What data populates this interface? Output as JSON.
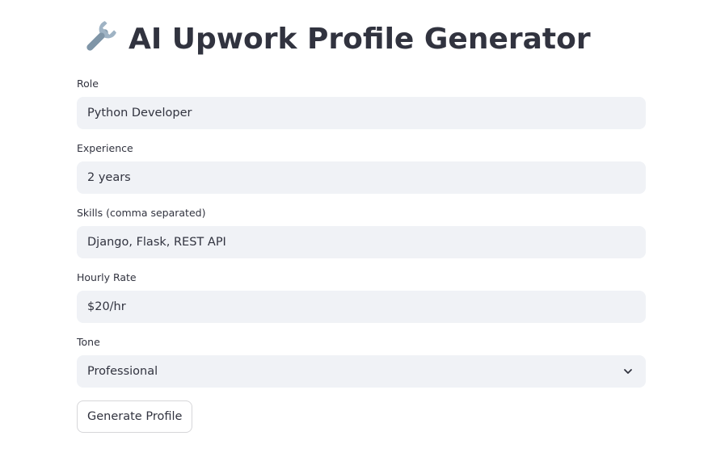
{
  "header": {
    "title": "AI Upwork Profile Generator",
    "icon": "wrench-icon"
  },
  "form": {
    "role": {
      "label": "Role",
      "value": "Python Developer"
    },
    "experience": {
      "label": "Experience",
      "value": "2 years"
    },
    "skills": {
      "label": "Skills (comma separated)",
      "value": "Django, Flask, REST API"
    },
    "rate": {
      "label": "Hourly Rate",
      "value": "$20/hr"
    },
    "tone": {
      "label": "Tone",
      "value": "Professional"
    },
    "submit_label": "Generate Profile"
  },
  "colors": {
    "input_background": "#f0f2f6",
    "text": "#31333f",
    "icon_wrench": "#7a8fa0"
  }
}
